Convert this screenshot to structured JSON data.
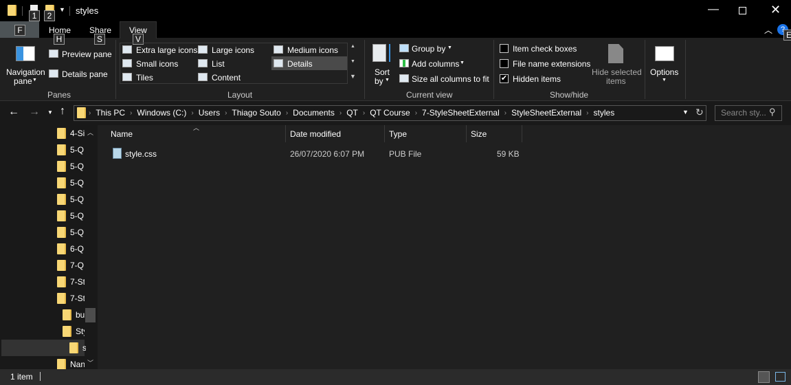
{
  "window": {
    "title": "styles",
    "qat_keys": [
      "1",
      "2"
    ]
  },
  "tabs": [
    {
      "label": "Home",
      "key": "H"
    },
    {
      "label": "Share",
      "key": "S"
    },
    {
      "label": "View",
      "key": "V"
    }
  ],
  "file_tab_key": "F",
  "help_key": "E",
  "ribbon": {
    "panes": {
      "group": "Panes",
      "navigation_pane": "Navigation",
      "navigation_pane2": "pane",
      "preview_pane": "Preview pane",
      "details_pane": "Details pane"
    },
    "layout": {
      "group": "Layout",
      "items": [
        "Extra large icons",
        "Large icons",
        "Medium icons",
        "Small icons",
        "List",
        "Details",
        "Tiles",
        "Content"
      ],
      "selected": "Details"
    },
    "current_view": {
      "group": "Current view",
      "sort_by": "Sort",
      "sort_by2": "by",
      "group_by": "Group by",
      "add_columns": "Add columns",
      "size_all": "Size all columns to fit"
    },
    "show_hide": {
      "group": "Show/hide",
      "item_check_boxes": "Item check boxes",
      "file_name_extensions": "File name extensions",
      "hidden_items": "Hidden items",
      "hide_selected": "Hide selected",
      "hide_selected2": "items",
      "checked": {
        "item_check_boxes": false,
        "file_name_extensions": false,
        "hidden_items": true
      }
    },
    "options": "Options"
  },
  "address": {
    "crumbs": [
      "This PC",
      "Windows (C:)",
      "Users",
      "Thiago Souto",
      "Documents",
      "QT",
      "QT Course",
      "7-StyleSheetExternal",
      "StyleSheetExternal",
      "styles"
    ],
    "search_placeholder": "Search sty..."
  },
  "nav_tree": [
    {
      "label": "4-Si",
      "indent": 0
    },
    {
      "label": "5-Q",
      "indent": 0
    },
    {
      "label": "5-Q",
      "indent": 0
    },
    {
      "label": "5-Q",
      "indent": 0
    },
    {
      "label": "5-Q",
      "indent": 0
    },
    {
      "label": "5-Q",
      "indent": 0
    },
    {
      "label": "5-Q",
      "indent": 0
    },
    {
      "label": "6-Q",
      "indent": 0
    },
    {
      "label": "7-Q",
      "indent": 0
    },
    {
      "label": "7-St",
      "indent": 0
    },
    {
      "label": "7-St",
      "indent": 0
    },
    {
      "label": "bu",
      "indent": 1
    },
    {
      "label": "Sty",
      "indent": 1
    },
    {
      "label": "s",
      "indent": 2,
      "selected": true
    },
    {
      "label": "Nan",
      "indent": 0
    }
  ],
  "columns": {
    "name": "Name",
    "date": "Date modified",
    "type": "Type",
    "size": "Size"
  },
  "files": [
    {
      "name": "style.css",
      "date": "26/07/2020 6:07 PM",
      "type": "PUB File",
      "size": "59 KB"
    }
  ],
  "status": {
    "count": "1 item"
  }
}
